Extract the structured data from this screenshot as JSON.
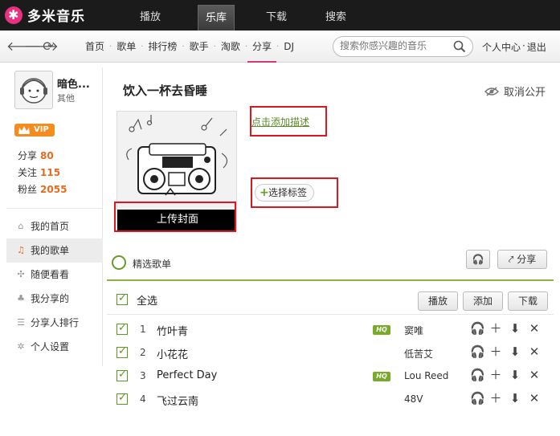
{
  "app": {
    "name": "多米音乐",
    "brand_color": "#e8317f",
    "accent_green": "#5a9a22",
    "highlight_red": "#e0151d"
  },
  "top_tabs": [
    {
      "label": "播放",
      "active": false
    },
    {
      "label": "乐库",
      "active": true
    },
    {
      "label": "下载",
      "active": false
    },
    {
      "label": "搜索",
      "active": false
    }
  ],
  "nav": {
    "back_icon": "arrow-left-icon",
    "forward_icon": "arrow-right-icon",
    "refresh_icon": "refresh-icon",
    "links": [
      {
        "label": "首页",
        "active": false
      },
      {
        "label": "歌单",
        "active": false
      },
      {
        "label": "排行榜",
        "active": false
      },
      {
        "label": "歌手",
        "active": false
      },
      {
        "label": "淘歌",
        "active": false
      },
      {
        "label": "分享",
        "active": true
      },
      {
        "label": "DJ",
        "active": false
      }
    ],
    "search_placeholder": "搜索你感兴趣的音乐",
    "user_center": "个人中心",
    "sep": "·",
    "logout": "退出"
  },
  "profile": {
    "name": "暗色...",
    "role": "其他",
    "vip_label": "VIP",
    "stats": [
      {
        "label": "分享",
        "value": "80"
      },
      {
        "label": "关注",
        "value": "115"
      },
      {
        "label": "粉丝",
        "value": "2055"
      }
    ]
  },
  "side_menu": [
    {
      "label": "我的首页",
      "icon": "home-icon",
      "active": false
    },
    {
      "label": "我的歌单",
      "icon": "music-notes-icon",
      "active": true
    },
    {
      "label": "随便看看",
      "icon": "shuffle-icon",
      "active": false
    },
    {
      "label": "我分享的",
      "icon": "share-user-icon",
      "active": false
    },
    {
      "label": "分享人排行",
      "icon": "ranking-icon",
      "active": false
    },
    {
      "label": "个人设置",
      "icon": "gear-icon",
      "active": false
    }
  ],
  "playlist": {
    "title": "饮入一杯去昏睡",
    "unpublic_label": "取消公开",
    "upload_cover": "上传封面",
    "add_desc": "点击添加描述",
    "select_tags": "选择标签",
    "picked_label": "精选歌单",
    "share_label": "分享",
    "select_all": "全选",
    "play_btn": "播放",
    "add_btn": "添加",
    "download_btn": "下载"
  },
  "songs": [
    {
      "num": "1",
      "title": "竹叶青",
      "hq": true,
      "hq_label": "HQ",
      "artist": "窦唯"
    },
    {
      "num": "2",
      "title": "小花花",
      "hq": false,
      "hq_label": "",
      "artist": "低苦艾"
    },
    {
      "num": "3",
      "title": "Perfect Day",
      "hq": true,
      "hq_label": "HQ",
      "artist": "Lou Reed"
    },
    {
      "num": "4",
      "title": "飞过云南",
      "hq": false,
      "hq_label": "",
      "artist": "48V"
    }
  ]
}
